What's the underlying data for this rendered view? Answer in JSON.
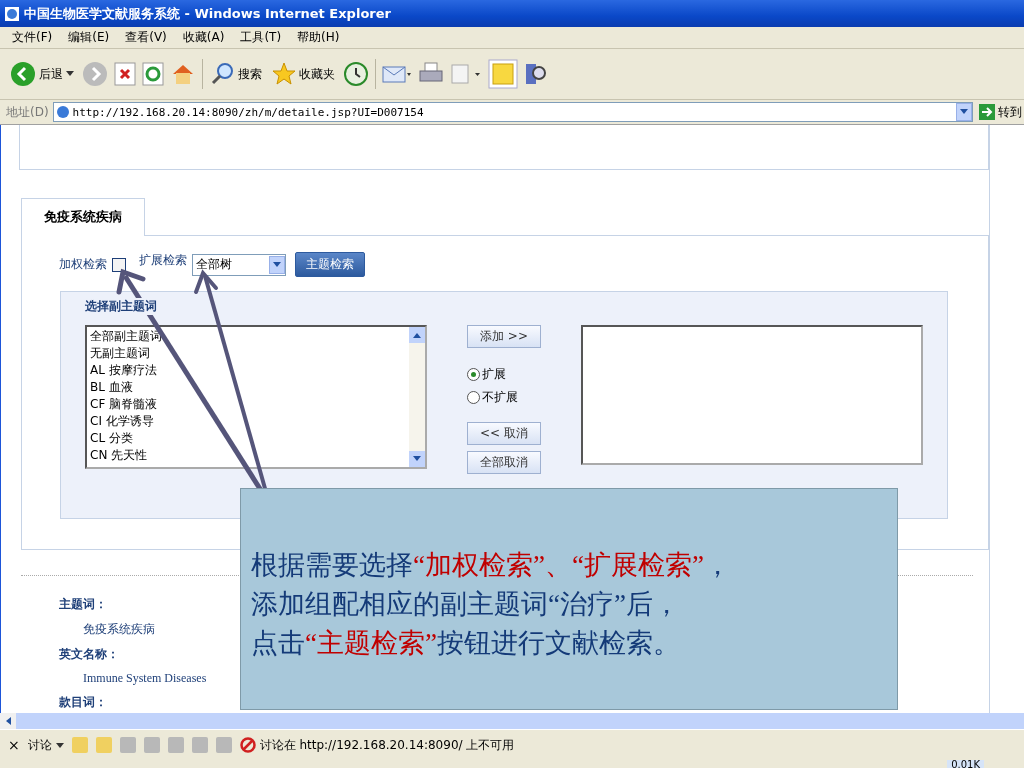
{
  "window": {
    "title": "中国生物医学文献服务系统 - Windows Internet Explorer"
  },
  "menu": [
    "文件(F)",
    "编辑(E)",
    "查看(V)",
    "收藏(A)",
    "工具(T)",
    "帮助(H)"
  ],
  "toolbar": {
    "back": "后退",
    "search": "搜索",
    "favorites": "收藏夹"
  },
  "address": {
    "label": "地址(D)",
    "url": "http://192.168.20.14:8090/zh/m/detaile.jsp?UI=D007154",
    "go": "转到"
  },
  "tab": {
    "label": "免疫系统疾病"
  },
  "search_options": {
    "weighted": {
      "label": "加权检索",
      "checked": false
    },
    "expand": {
      "label": "扩展检索",
      "value": "全部树"
    },
    "button": "主题检索"
  },
  "subheadings": {
    "title": "选择副主题词",
    "items": [
      "全部副主题词",
      "无副主题词",
      "AL 按摩疗法",
      "BL 血液",
      "CF 脑脊髓液",
      "CI 化学诱导",
      "CL 分类",
      "CN 先天性"
    ],
    "add": "添加 >>",
    "radios": [
      {
        "label": "扩展",
        "selected": true
      },
      {
        "label": "不扩展",
        "selected": false
      }
    ],
    "remove": "<< 取消",
    "remove_all": "全部取消"
  },
  "fields": [
    {
      "label": "主题词：",
      "value": "免疫系统疾病"
    },
    {
      "label": "英文名称：",
      "value": "Immune System Diseases"
    },
    {
      "label": "款目词："
    }
  ],
  "discussion_bar": {
    "close": "×",
    "menu": "讨论",
    "message": "讨论在 http://192.168.20.14:8090/ 上不可用"
  },
  "tray": {
    "speed": "0.01K"
  },
  "callout": {
    "lines": [
      [
        {
          "text": "根据需要选择",
          "highlight": false
        },
        {
          "text": "“加权检索”、“扩展检索”",
          "highlight": true
        },
        {
          "text": "，",
          "highlight": false
        }
      ],
      [
        {
          "text": "添加组配相应的副主题词“治疗”后，",
          "highlight": false
        }
      ],
      [
        {
          "text": "点击",
          "highlight": false
        },
        {
          "text": "“主题检索”",
          "highlight": true
        },
        {
          "text": "按钮进行文献检索。",
          "highlight": false
        }
      ]
    ]
  }
}
